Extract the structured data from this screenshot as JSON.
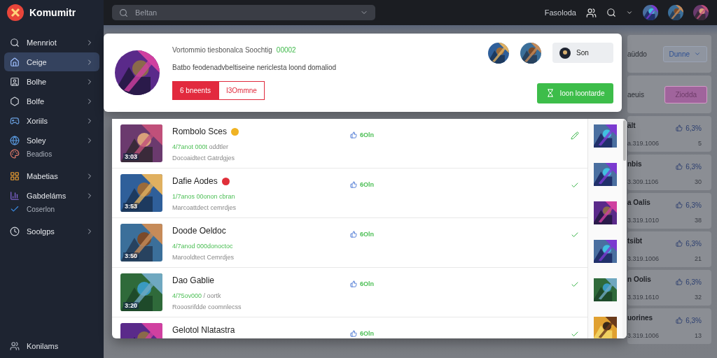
{
  "app": {
    "name": "Komumitr"
  },
  "search": {
    "placeholder": "Beltan"
  },
  "topbar": {
    "label": "Fasoloda"
  },
  "sidebar": {
    "items": [
      {
        "label": "Mennriot",
        "kind": "item",
        "selected": false
      },
      {
        "label": "Ceige",
        "kind": "item",
        "selected": true
      },
      {
        "label": "Bolhe",
        "kind": "item",
        "selected": false
      },
      {
        "label": "Bolfe",
        "kind": "item",
        "selected": false
      },
      {
        "label": "Xoriils",
        "kind": "item",
        "selected": false
      },
      {
        "label": "Soley",
        "kind": "item",
        "selected": false
      },
      {
        "label": "Beadios",
        "kind": "sub",
        "selected": false
      },
      {
        "label": "Mabetias",
        "kind": "item",
        "selected": false
      },
      {
        "label": "Gabdeláms",
        "kind": "item",
        "selected": false
      },
      {
        "label": "Coserlon",
        "kind": "sub",
        "selected": false
      },
      {
        "label": "Soolgps",
        "kind": "item",
        "selected": false
      }
    ],
    "footer": "Konilams"
  },
  "header_card": {
    "title": "Vortommio tiesbonalca Soochtig",
    "count": "00002",
    "description": "Batbo feodenadvbeltiseine nericlesta loond domaliod",
    "segments": [
      {
        "label": "6 bneents",
        "selected": true
      },
      {
        "label": "I3Ommne",
        "selected": false
      }
    ],
    "chip": "Son",
    "action": "Ioon loontarde"
  },
  "rows": [
    {
      "title": "Rombolo Sces",
      "color": "#f0b323",
      "meta": "4/7anot 000t",
      "meta_tail": "oddtler",
      "info": "Docoaidtect Gatrdgjes",
      "duration": "3:03",
      "likes": "6Oln"
    },
    {
      "title": "Dafie Aodes",
      "color": "#e0303a",
      "meta": "1/7anos 00onon cbran",
      "info": "Marcoattdect cemrdjes",
      "duration": "3:53",
      "likes": "6Oln"
    },
    {
      "title": "Doode Oeldoc",
      "meta": "4/7anod 000donoctoc",
      "info": "Marooldtect Cemrdjes",
      "duration": "3:50",
      "likes": "6Oln"
    },
    {
      "title": "Dao Gablie",
      "meta": "4/75ov000",
      "meta_tail": "/ oortk",
      "info": "Rooosrifdde coomnlecss",
      "duration": "3:20",
      "likes": "6Oln"
    },
    {
      "title": "Gelotol Nlatastra",
      "likes": "6Oln"
    }
  ],
  "side_filters": [
    {
      "label": "aüddo",
      "control": "Dunne",
      "kind": "dropdown"
    },
    {
      "label": "aeuis",
      "control": "Ziodda",
      "kind": "button"
    }
  ],
  "side_cards": [
    {
      "title": "ält",
      "meta": "a.319.1006",
      "likes": "6,3%",
      "count": "5"
    },
    {
      "title": "nbis",
      "meta": "3.309.1106",
      "likes": "6,3%",
      "count": "30"
    },
    {
      "title": "a Oalis",
      "meta": "3.319.1010",
      "likes": "6,3%",
      "count": "38"
    },
    {
      "title": "tsibt",
      "meta": "3.319.1006",
      "likes": "6,3%",
      "count": "21"
    },
    {
      "title": "n Oolis",
      "meta": "3.319.1610",
      "likes": "6,3%",
      "count": "32"
    },
    {
      "title": "uorines",
      "meta": "3.319.1006",
      "likes": "6,3%",
      "count": "13"
    }
  ]
}
